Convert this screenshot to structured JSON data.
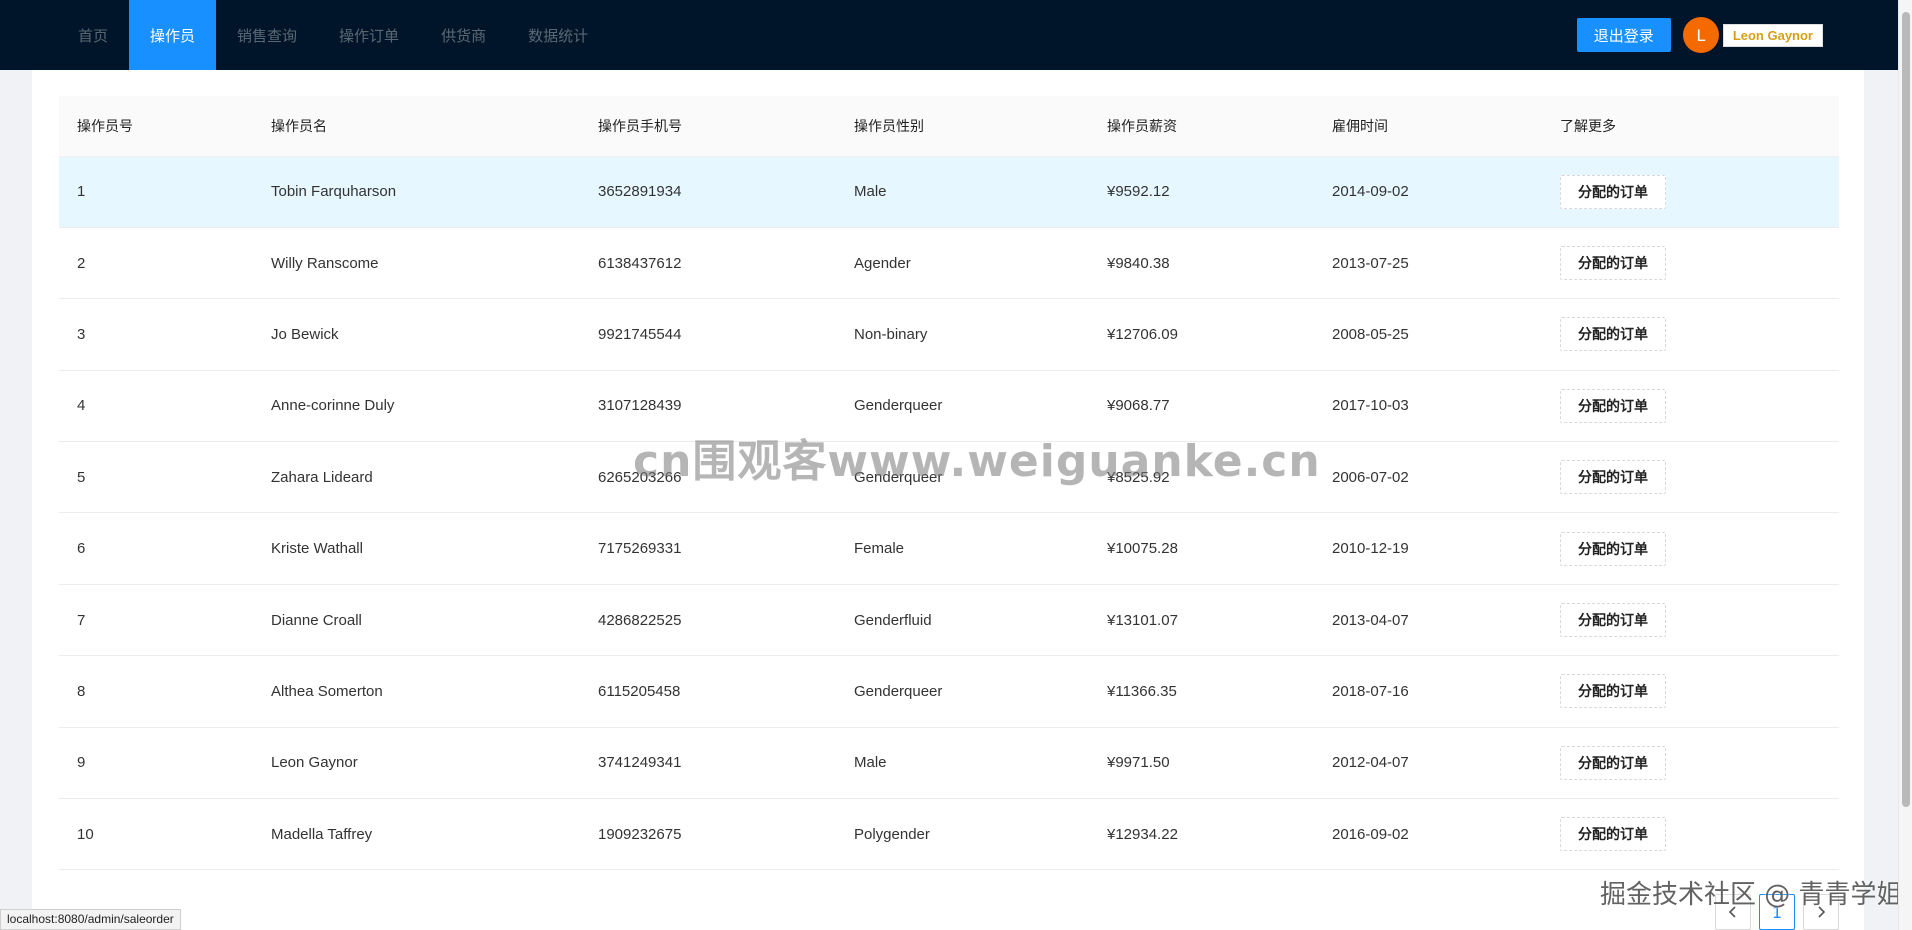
{
  "nav": {
    "items": [
      {
        "label": "首页"
      },
      {
        "label": "操作员"
      },
      {
        "label": "销售查询"
      },
      {
        "label": "操作订单"
      },
      {
        "label": "供货商"
      },
      {
        "label": "数据统计"
      }
    ],
    "logout_label": "退出登录",
    "avatar_letter": "L",
    "username": "Leon Gaynor"
  },
  "table": {
    "columns": [
      "操作员号",
      "操作员名",
      "操作员手机号",
      "操作员性别",
      "操作员薪资",
      "雇佣时间",
      "了解更多"
    ],
    "action_label": "分配的订单",
    "rows": [
      {
        "id": "1",
        "name": "Tobin Farquharson",
        "phone": "3652891934",
        "gender": "Male",
        "salary": "¥9592.12",
        "hired": "2014-09-02"
      },
      {
        "id": "2",
        "name": "Willy Ranscome",
        "phone": "6138437612",
        "gender": "Agender",
        "salary": "¥9840.38",
        "hired": "2013-07-25"
      },
      {
        "id": "3",
        "name": "Jo Bewick",
        "phone": "9921745544",
        "gender": "Non-binary",
        "salary": "¥12706.09",
        "hired": "2008-05-25"
      },
      {
        "id": "4",
        "name": "Anne-corinne Duly",
        "phone": "3107128439",
        "gender": "Genderqueer",
        "salary": "¥9068.77",
        "hired": "2017-10-03"
      },
      {
        "id": "5",
        "name": "Zahara Lideard",
        "phone": "6265203266",
        "gender": "Genderqueer",
        "salary": "¥8525.92",
        "hired": "2006-07-02"
      },
      {
        "id": "6",
        "name": "Kriste Wathall",
        "phone": "7175269331",
        "gender": "Female",
        "salary": "¥10075.28",
        "hired": "2010-12-19"
      },
      {
        "id": "7",
        "name": "Dianne Croall",
        "phone": "4286822525",
        "gender": "Genderfluid",
        "salary": "¥13101.07",
        "hired": "2013-04-07"
      },
      {
        "id": "8",
        "name": "Althea Somerton",
        "phone": "6115205458",
        "gender": "Genderqueer",
        "salary": "¥11366.35",
        "hired": "2018-07-16"
      },
      {
        "id": "9",
        "name": "Leon Gaynor",
        "phone": "3741249341",
        "gender": "Male",
        "salary": "¥9971.50",
        "hired": "2012-04-07"
      },
      {
        "id": "10",
        "name": "Madella Taffrey",
        "phone": "1909232675",
        "gender": "Polygender",
        "salary": "¥12934.22",
        "hired": "2016-09-02"
      }
    ]
  },
  "pagination": {
    "current_page": "1",
    "prev_icon": "chevron-left-icon",
    "next_icon": "chevron-right-icon"
  },
  "watermark": {
    "center_text": "cn围观客www.weiguanke.cn",
    "corner_text": "掘金技术社区 @ 青青学姐"
  },
  "statusbar": {
    "url": "localhost:8080/admin/saleorder"
  },
  "colors": {
    "nav_bg": "#001529",
    "accent": "#1890ff",
    "avatar_bg": "#f56a00",
    "highlight_row": "#e6f7ff"
  }
}
